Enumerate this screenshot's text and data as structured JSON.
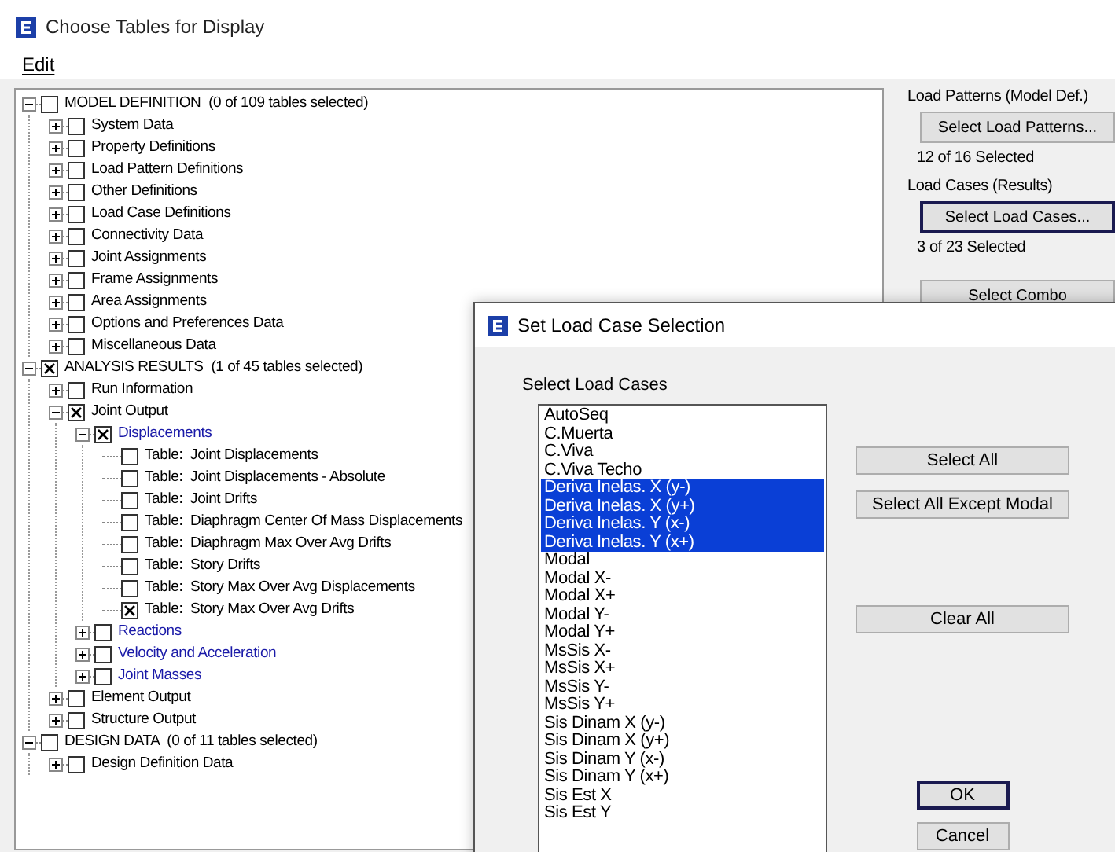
{
  "window": {
    "title": "Choose Tables for Display",
    "menu": [
      "Edit"
    ]
  },
  "tree": [
    {
      "label": "MODEL DEFINITION  (0 of 109 tables selected)",
      "kind": "item",
      "expanded": true,
      "checked": false,
      "children": [
        {
          "label": "System Data",
          "kind": "item",
          "expanded": false,
          "checked": false
        },
        {
          "label": "Property Definitions",
          "kind": "item",
          "expanded": false,
          "checked": false
        },
        {
          "label": "Load Pattern Definitions",
          "kind": "item",
          "expanded": false,
          "checked": false
        },
        {
          "label": "Other Definitions",
          "kind": "item",
          "expanded": false,
          "checked": false
        },
        {
          "label": "Load Case Definitions",
          "kind": "item",
          "expanded": false,
          "checked": false
        },
        {
          "label": "Connectivity Data",
          "kind": "item",
          "expanded": false,
          "checked": false
        },
        {
          "label": "Joint Assignments",
          "kind": "item",
          "expanded": false,
          "checked": false
        },
        {
          "label": "Frame Assignments",
          "kind": "item",
          "expanded": false,
          "checked": false
        },
        {
          "label": "Area Assignments",
          "kind": "item",
          "expanded": false,
          "checked": false
        },
        {
          "label": "Options and Preferences Data",
          "kind": "item",
          "expanded": false,
          "checked": false
        },
        {
          "label": "Miscellaneous Data",
          "kind": "item",
          "expanded": false,
          "checked": false
        }
      ]
    },
    {
      "label": "ANALYSIS RESULTS  (1 of 45 tables selected)",
      "kind": "item",
      "expanded": true,
      "checked": true,
      "children": [
        {
          "label": "Run Information",
          "kind": "item",
          "expanded": false,
          "checked": false
        },
        {
          "label": "Joint Output",
          "kind": "item",
          "expanded": true,
          "checked": true,
          "children": [
            {
              "label": "Displacements",
              "kind": "category",
              "expanded": true,
              "checked": true,
              "children": [
                {
                  "label": "Table:  Joint Displacements",
                  "kind": "item",
                  "checked": false
                },
                {
                  "label": "Table:  Joint Displacements - Absolute",
                  "kind": "item",
                  "checked": false
                },
                {
                  "label": "Table:  Joint Drifts",
                  "kind": "item",
                  "checked": false
                },
                {
                  "label": "Table:  Diaphragm Center Of Mass Displacements",
                  "kind": "item",
                  "checked": false
                },
                {
                  "label": "Table:  Diaphragm Max Over Avg Drifts",
                  "kind": "item",
                  "checked": false
                },
                {
                  "label": "Table:  Story Drifts",
                  "kind": "item",
                  "checked": false
                },
                {
                  "label": "Table:  Story Max Over Avg Displacements",
                  "kind": "item",
                  "checked": false
                },
                {
                  "label": "Table:  Story Max Over Avg Drifts",
                  "kind": "item",
                  "checked": true
                }
              ]
            },
            {
              "label": "Reactions",
              "kind": "category",
              "expanded": false,
              "checked": false
            },
            {
              "label": "Velocity and Acceleration",
              "kind": "category",
              "expanded": false,
              "checked": false
            },
            {
              "label": "Joint Masses",
              "kind": "category",
              "expanded": false,
              "checked": false
            }
          ]
        },
        {
          "label": "Element Output",
          "kind": "item",
          "expanded": false,
          "checked": false
        },
        {
          "label": "Structure Output",
          "kind": "item",
          "expanded": false,
          "checked": false
        }
      ]
    },
    {
      "label": "DESIGN DATA  (0 of 11 tables selected)",
      "kind": "item",
      "expanded": true,
      "checked": false,
      "children": [
        {
          "label": "Design Definition Data",
          "kind": "item",
          "expanded": false,
          "checked": false
        }
      ]
    }
  ],
  "side_panel": {
    "load_patterns_label": "Load Patterns (Model Def.)",
    "load_patterns_button": "Select Load Patterns...",
    "load_patterns_count": "12 of 16 Selected",
    "load_cases_label": "Load Cases (Results)",
    "load_cases_button": "Select Load Cases...",
    "load_cases_count": "3 of 23 Selected",
    "combos_button": "Select Combo"
  },
  "dialog": {
    "title": "Set Load Case Selection",
    "list_label": "Select Load Cases",
    "load_cases": [
      {
        "label": "AutoSeq",
        "selected": false
      },
      {
        "label": "C.Muerta",
        "selected": false
      },
      {
        "label": "C.Viva",
        "selected": false
      },
      {
        "label": "C.Viva Techo",
        "selected": false
      },
      {
        "label": "Deriva Inelas. X (y-)",
        "selected": true
      },
      {
        "label": "Deriva Inelas. X (y+)",
        "selected": true
      },
      {
        "label": "Deriva Inelas. Y (x-)",
        "selected": true
      },
      {
        "label": "Deriva Inelas. Y (x+)",
        "selected": true
      },
      {
        "label": "Modal",
        "selected": false
      },
      {
        "label": "Modal X-",
        "selected": false
      },
      {
        "label": "Modal X+",
        "selected": false
      },
      {
        "label": "Modal Y-",
        "selected": false
      },
      {
        "label": "Modal Y+",
        "selected": false
      },
      {
        "label": "MsSis X-",
        "selected": false
      },
      {
        "label": "MsSis X+",
        "selected": false
      },
      {
        "label": "MsSis Y-",
        "selected": false
      },
      {
        "label": "MsSis Y+",
        "selected": false
      },
      {
        "label": "Sis Dinam X (y-)",
        "selected": false
      },
      {
        "label": "Sis Dinam X (y+)",
        "selected": false
      },
      {
        "label": "Sis Dinam Y (x-)",
        "selected": false
      },
      {
        "label": "Sis Dinam Y (x+)",
        "selected": false
      },
      {
        "label": "Sis Est X",
        "selected": false
      },
      {
        "label": "Sis Est Y",
        "selected": false
      }
    ],
    "select_all": "Select All",
    "select_all_except_modal": "Select All Except Modal",
    "clear_all": "Clear All",
    "ok": "OK",
    "cancel": "Cancel"
  }
}
